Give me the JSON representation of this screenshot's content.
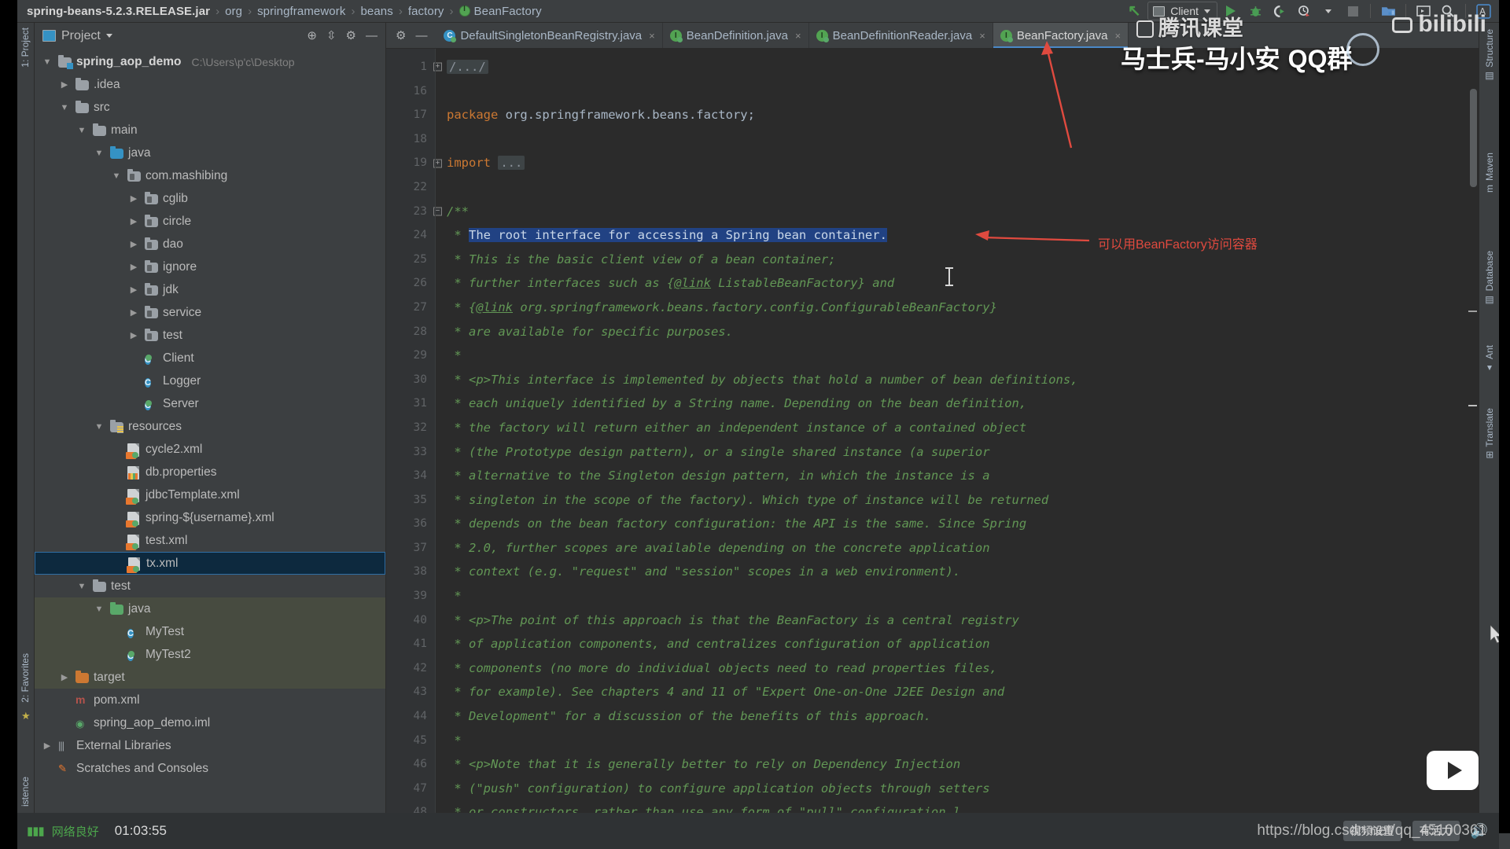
{
  "app": {
    "name": "IntelliJ IDEA",
    "theme_bg": "#3c3f41",
    "editor_bg": "#2b2b2b",
    "accent": "#4a88c7",
    "annotation_color": "#e04a3f"
  },
  "topbar": {
    "breadcrumb": [
      {
        "label": "spring-beans-5.2.3.RELEASE.jar",
        "type": "jar"
      },
      {
        "label": "org",
        "type": "package"
      },
      {
        "label": "springframework",
        "type": "package"
      },
      {
        "label": "beans",
        "type": "package"
      },
      {
        "label": "factory",
        "type": "package"
      },
      {
        "label": "BeanFactory",
        "type": "interface"
      }
    ],
    "separator": "›",
    "run_config": "Client",
    "icons": [
      "jump-to-source-icon",
      "run-icon",
      "debug-icon",
      "run-coverage-icon",
      "profiler-icon",
      "stop-icon",
      "build-project-icon",
      "select-run-window-icon",
      "search-everywhere-icon",
      "translate-icon"
    ]
  },
  "left_rail": {
    "project_label": "1: Project",
    "favorites_label": "2: Favorites",
    "structure_label": "istence"
  },
  "right_rail": {
    "items": [
      "Structure",
      "Maven",
      "Database",
      "Ant",
      "Translate"
    ]
  },
  "project_panel": {
    "title": "Project",
    "header_icons": [
      "locate-icon",
      "collapse-all-icon",
      "settings-icon",
      "hide-icon"
    ],
    "tree": [
      {
        "depth": 0,
        "twisty": "▼",
        "icon": "project-folder",
        "label": "spring_aop_demo",
        "bold": true,
        "path": "C:\\Users\\p'c\\Desktop"
      },
      {
        "depth": 1,
        "twisty": "▶",
        "icon": "folder",
        "label": ".idea"
      },
      {
        "depth": 1,
        "twisty": "▼",
        "icon": "folder",
        "label": "src"
      },
      {
        "depth": 2,
        "twisty": "▼",
        "icon": "folder",
        "label": "main"
      },
      {
        "depth": 3,
        "twisty": "▼",
        "icon": "folder-blue",
        "label": "java"
      },
      {
        "depth": 4,
        "twisty": "▼",
        "icon": "package",
        "label": "com.mashibing"
      },
      {
        "depth": 5,
        "twisty": "▶",
        "icon": "package",
        "label": "cglib"
      },
      {
        "depth": 5,
        "twisty": "▶",
        "icon": "package",
        "label": "circle"
      },
      {
        "depth": 5,
        "twisty": "▶",
        "icon": "package",
        "label": "dao"
      },
      {
        "depth": 5,
        "twisty": "▶",
        "icon": "package",
        "label": "ignore"
      },
      {
        "depth": 5,
        "twisty": "▶",
        "icon": "package",
        "label": "jdk"
      },
      {
        "depth": 5,
        "twisty": "▶",
        "icon": "package",
        "label": "service"
      },
      {
        "depth": 5,
        "twisty": "▶",
        "icon": "package",
        "label": "test"
      },
      {
        "depth": 5,
        "twisty": "",
        "icon": "class-runnable",
        "label": "Client"
      },
      {
        "depth": 5,
        "twisty": "",
        "icon": "class",
        "label": "Logger"
      },
      {
        "depth": 5,
        "twisty": "",
        "icon": "class-runnable",
        "label": "Server"
      },
      {
        "depth": 3,
        "twisty": "▼",
        "icon": "resources-folder",
        "label": "resources"
      },
      {
        "depth": 4,
        "twisty": "",
        "icon": "xml",
        "label": "cycle2.xml"
      },
      {
        "depth": 4,
        "twisty": "",
        "icon": "properties",
        "label": "db.properties"
      },
      {
        "depth": 4,
        "twisty": "",
        "icon": "xml",
        "label": "jdbcTemplate.xml"
      },
      {
        "depth": 4,
        "twisty": "",
        "icon": "xml",
        "label": "spring-${username}.xml"
      },
      {
        "depth": 4,
        "twisty": "",
        "icon": "xml",
        "label": "test.xml"
      },
      {
        "depth": 4,
        "twisty": "",
        "icon": "xml",
        "label": "tx.xml",
        "selected": true
      },
      {
        "depth": 2,
        "twisty": "▼",
        "icon": "folder",
        "label": "test"
      },
      {
        "depth": 3,
        "twisty": "▼",
        "icon": "folder-green",
        "label": "java",
        "testsrc": true
      },
      {
        "depth": 4,
        "twisty": "",
        "icon": "class",
        "label": "MyTest",
        "testsrc": true
      },
      {
        "depth": 4,
        "twisty": "",
        "icon": "class-runnable",
        "label": "MyTest2",
        "testsrc": true
      },
      {
        "depth": 1,
        "twisty": "▶",
        "icon": "folder-orange",
        "label": "target",
        "testsrc": true
      },
      {
        "depth": 1,
        "twisty": "",
        "icon": "maven",
        "label": "pom.xml"
      },
      {
        "depth": 1,
        "twisty": "",
        "icon": "module",
        "label": "spring_aop_demo.iml"
      },
      {
        "depth": 0,
        "twisty": "▶",
        "icon": "library",
        "label": "External Libraries"
      },
      {
        "depth": 0,
        "twisty": "",
        "icon": "scratch",
        "label": "Scratches and Consoles"
      }
    ]
  },
  "editor": {
    "tabs": [
      {
        "label": "DefaultSingletonBeanRegistry.java",
        "icon": "class",
        "active": false,
        "closable": true
      },
      {
        "label": "BeanDefinition.java",
        "icon": "interface",
        "active": false,
        "closable": true
      },
      {
        "label": "BeanDefinitionReader.java",
        "icon": "interface",
        "active": false,
        "closable": true
      },
      {
        "label": "BeanFactory.java",
        "icon": "interface",
        "active": true,
        "closable": true
      }
    ],
    "tab_tool_icons": [
      "settings-gear-icon",
      "hide-editor-icon"
    ],
    "lines": [
      {
        "num": "1",
        "fold": "plus",
        "segments": [
          {
            "t": "folded",
            "v": "/.../"
          }
        ]
      },
      {
        "num": "16",
        "fold": "",
        "segments": []
      },
      {
        "num": "17",
        "fold": "",
        "segments": [
          {
            "t": "kw",
            "v": "package"
          },
          {
            "t": "plain",
            "v": " org.springframework.beans.factory;"
          }
        ]
      },
      {
        "num": "18",
        "fold": "",
        "segments": []
      },
      {
        "num": "19",
        "fold": "plus",
        "segments": [
          {
            "t": "kw",
            "v": "import"
          },
          {
            "t": "plain",
            "v": " "
          },
          {
            "t": "folded",
            "v": "..."
          }
        ]
      },
      {
        "num": "22",
        "fold": "",
        "segments": []
      },
      {
        "num": "23",
        "fold": "minus",
        "segments": [
          {
            "t": "cmt",
            "v": "/**"
          }
        ]
      },
      {
        "num": "24",
        "fold": "",
        "segments": [
          {
            "t": "cmt",
            "v": " * "
          },
          {
            "t": "sel",
            "v": "The root interface for accessing a Spring bean container."
          }
        ]
      },
      {
        "num": "25",
        "fold": "",
        "segments": [
          {
            "t": "cmt",
            "v": " * This is the basic client view of a bean container;"
          }
        ]
      },
      {
        "num": "26",
        "fold": "",
        "segments": [
          {
            "t": "cmt",
            "v": " * further interfaces such as {"
          },
          {
            "t": "link",
            "v": "@link"
          },
          {
            "t": "cmt",
            "v": " ListableBeanFactory} and"
          }
        ]
      },
      {
        "num": "27",
        "fold": "",
        "segments": [
          {
            "t": "cmt",
            "v": " * {"
          },
          {
            "t": "link",
            "v": "@link"
          },
          {
            "t": "cmt",
            "v": " org.springframework.beans.factory.config.ConfigurableBeanFactory}"
          }
        ]
      },
      {
        "num": "28",
        "fold": "",
        "segments": [
          {
            "t": "cmt",
            "v": " * are available for specific purposes."
          }
        ]
      },
      {
        "num": "29",
        "fold": "",
        "segments": [
          {
            "t": "cmt",
            "v": " *"
          }
        ]
      },
      {
        "num": "30",
        "fold": "",
        "segments": [
          {
            "t": "cmt",
            "v": " * <p>This interface is implemented by objects that hold a number of bean definitions,"
          }
        ]
      },
      {
        "num": "31",
        "fold": "",
        "segments": [
          {
            "t": "cmt",
            "v": " * each uniquely identified by a String name. Depending on the bean definition,"
          }
        ]
      },
      {
        "num": "32",
        "fold": "",
        "segments": [
          {
            "t": "cmt",
            "v": " * the factory will return either an independent instance of a contained object"
          }
        ]
      },
      {
        "num": "33",
        "fold": "",
        "segments": [
          {
            "t": "cmt",
            "v": " * (the Prototype design pattern), or a single shared instance (a superior"
          }
        ]
      },
      {
        "num": "34",
        "fold": "",
        "segments": [
          {
            "t": "cmt",
            "v": " * alternative to the Singleton design pattern, in which the instance is a"
          }
        ]
      },
      {
        "num": "35",
        "fold": "",
        "segments": [
          {
            "t": "cmt",
            "v": " * singleton in the scope of the factory). Which type of instance will be returned"
          }
        ]
      },
      {
        "num": "36",
        "fold": "",
        "segments": [
          {
            "t": "cmt",
            "v": " * depends on the bean factory configuration: the API is the same. Since Spring"
          }
        ]
      },
      {
        "num": "37",
        "fold": "",
        "segments": [
          {
            "t": "cmt",
            "v": " * 2.0, further scopes are available depending on the concrete application"
          }
        ]
      },
      {
        "num": "38",
        "fold": "",
        "segments": [
          {
            "t": "cmt",
            "v": " * context (e.g. \"request\" and \"session\" scopes in a web environment)."
          }
        ]
      },
      {
        "num": "39",
        "fold": "",
        "segments": [
          {
            "t": "cmt",
            "v": " *"
          }
        ]
      },
      {
        "num": "40",
        "fold": "",
        "segments": [
          {
            "t": "cmt",
            "v": " * <p>The point of this approach is that the BeanFactory is a central registry"
          }
        ]
      },
      {
        "num": "41",
        "fold": "",
        "segments": [
          {
            "t": "cmt",
            "v": " * of application components, and centralizes configuration of application"
          }
        ]
      },
      {
        "num": "42",
        "fold": "",
        "segments": [
          {
            "t": "cmt",
            "v": " * components (no more do individual objects need to read properties files,"
          }
        ]
      },
      {
        "num": "43",
        "fold": "",
        "segments": [
          {
            "t": "cmt",
            "v": " * for example). See chapters 4 and 11 of \"Expert One-on-One J2EE Design and"
          }
        ]
      },
      {
        "num": "44",
        "fold": "",
        "segments": [
          {
            "t": "cmt",
            "v": " * Development\" for a discussion of the benefits of this approach."
          }
        ]
      },
      {
        "num": "45",
        "fold": "",
        "segments": [
          {
            "t": "cmt",
            "v": " *"
          }
        ]
      },
      {
        "num": "46",
        "fold": "",
        "segments": [
          {
            "t": "cmt",
            "v": " * <p>Note that it is generally better to rely on Dependency Injection"
          }
        ]
      },
      {
        "num": "47",
        "fold": "",
        "segments": [
          {
            "t": "cmt",
            "v": " * (\"push\" configuration) to configure application objects through setters"
          }
        ]
      },
      {
        "num": "48",
        "fold": "",
        "segments": [
          {
            "t": "cmt",
            "v": " * or constructors, rather than use any form of \"pull\" configuration l"
          }
        ]
      }
    ]
  },
  "annotations": [
    {
      "name": "beanfactory-tab-arrow",
      "text": ""
    },
    {
      "name": "beanfactory-doc-note",
      "text": "可以用BeanFactory访问容器"
    }
  ],
  "watermarks": {
    "tencent_classroom": "腾讯课堂",
    "bilibili": "bilibili",
    "instructor": "马士兵-马小安",
    "qq_group": "QQ群",
    "csdn": "https://blog.csdn.net/qq_45100361"
  },
  "bottombar": {
    "network_status": "网络良好",
    "clock": "01:03:55",
    "video_settings": "视频设置",
    "voice_chat": "有活力",
    "csdn_url": "https://blog.csdn.net/qq_45100361"
  }
}
